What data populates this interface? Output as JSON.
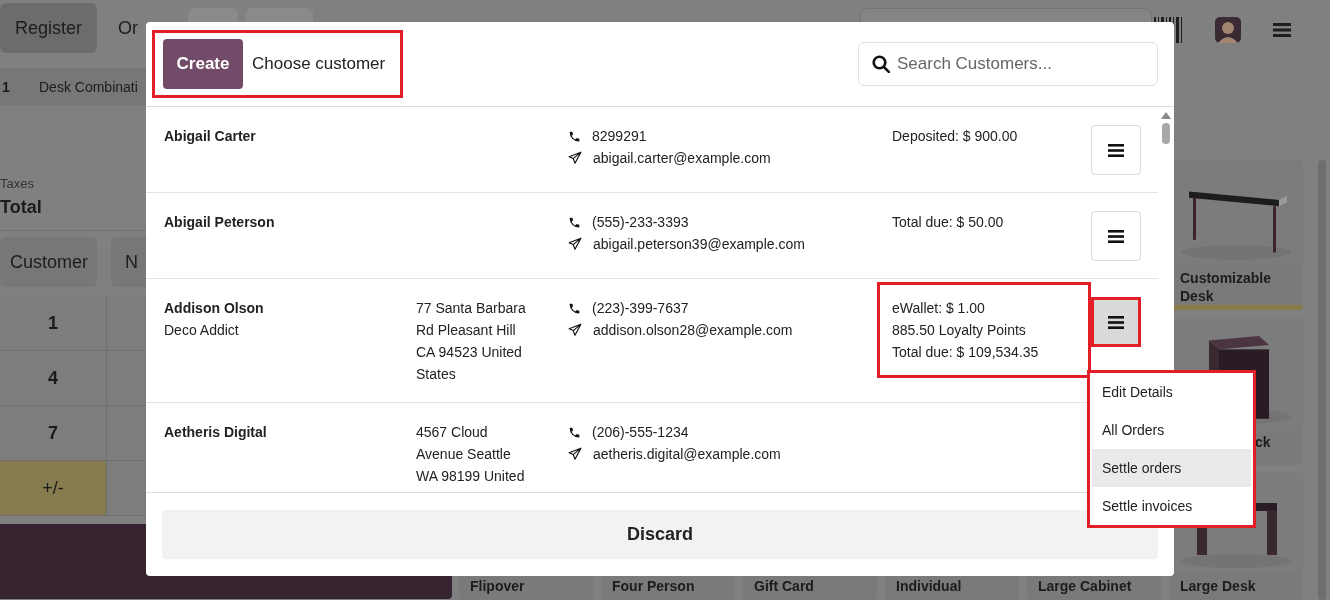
{
  "background": {
    "header": {
      "tabs": [
        {
          "label": "Register",
          "selected": true
        },
        {
          "label": "Or",
          "selected": false
        }
      ]
    },
    "order_line": {
      "quantity": "1",
      "product": "Desk Combinati"
    },
    "summary": {
      "taxes_label": "Taxes",
      "total_label": "Total"
    },
    "action_buttons": [
      "Customer",
      "N"
    ],
    "keypad": [
      {
        "label": "1",
        "kind": "digit"
      },
      {
        "label": "4",
        "kind": "digit"
      },
      {
        "label": "7",
        "kind": "digit"
      },
      {
        "label": "+/-",
        "kind": "sign"
      }
    ],
    "products": [
      {
        "name": "Customizable Desk",
        "kind": "picture"
      },
      {
        "name": "ck",
        "kind": "picture"
      },
      {
        "name": "Large Desk",
        "kind": "picture"
      }
    ],
    "bottom_products": [
      "Flipover",
      "Four Person",
      "Gift Card",
      "Individual",
      "Large Cabinet"
    ]
  },
  "dialog": {
    "create_button": "Create",
    "title": "Choose customer",
    "header_highlighted": true,
    "search": {
      "placeholder": "Search Customers..."
    },
    "customers": [
      {
        "name": "Abigail Carter",
        "phone": "8299291",
        "email": "abigail.carter@example.com",
        "balance": [
          "Deposited: $ 900.00"
        ],
        "menu_active": false
      },
      {
        "name": "Abigail Peterson",
        "phone": "(555)-233-3393",
        "email": "abigail.peterson39@example.com",
        "balance": [
          "Total due: $ 50.00"
        ],
        "menu_active": false
      },
      {
        "name": "Addison Olson",
        "company": "Deco Addict",
        "address": [
          "77 Santa Barbara",
          "Rd Pleasant Hill",
          "CA 94523 United",
          "States"
        ],
        "phone": "(223)-399-7637",
        "email": "addison.olson28@example.com",
        "balance": [
          "eWallet: $ 1.00",
          "885.50 Loyalty Points",
          "Total due: $ 109,534.35"
        ],
        "balance_highlighted": true,
        "menu_active": true,
        "menu_highlighted": true
      },
      {
        "name": "Aetheris Digital",
        "address": [
          "4567 Cloud",
          "Avenue Seattle",
          "WA 98199 United"
        ],
        "phone": "(206)-555-1234",
        "email": "aetheris.digital@example.com"
      }
    ],
    "discard_button": "Discard"
  },
  "dropdown": {
    "highlighted": true,
    "items": [
      {
        "label": "Edit Details",
        "selected": false
      },
      {
        "label": "All Orders",
        "selected": false
      },
      {
        "label": "Settle orders",
        "selected": true
      },
      {
        "label": "Settle invoices",
        "selected": false
      }
    ]
  }
}
